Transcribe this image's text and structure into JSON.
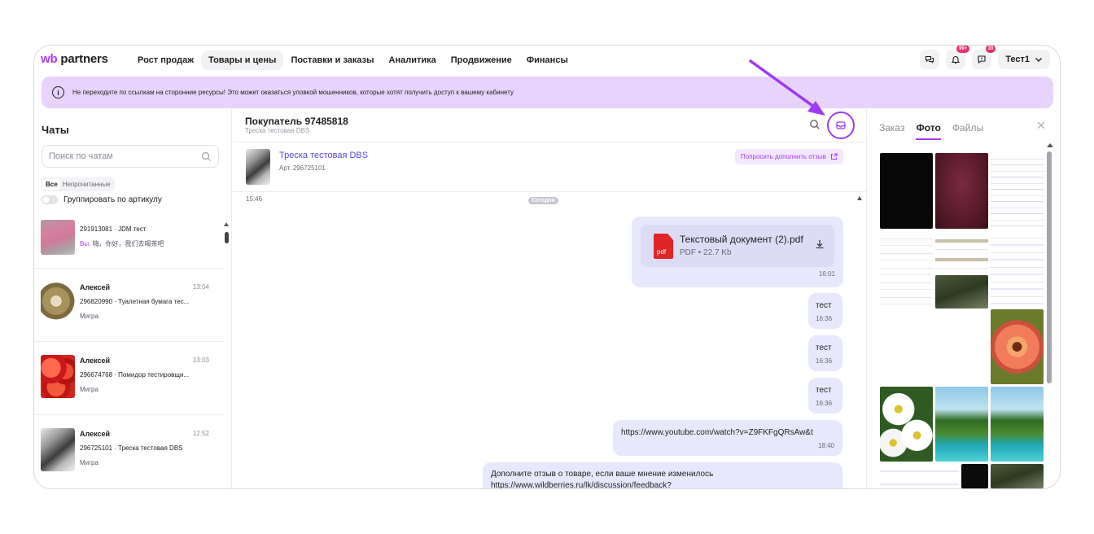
{
  "topnav": {
    "logo_wb": "wb",
    "logo_partners": "partners",
    "items": [
      "Рост продаж",
      "Товары и цены",
      "Поставки и заказы",
      "Аналитика",
      "Продвижение",
      "Финансы"
    ],
    "active_index": 1,
    "notifications_badge": "99+",
    "messages_badge": "30",
    "user_name": "Тест1"
  },
  "banner": {
    "text": "Не переходите по ссылкам на сторонние ресурсы! Это может оказаться уловкой мошенников, которые хотят получить доступ к вашему кабинету"
  },
  "chats": {
    "title": "Чаты",
    "search_placeholder": "Поиск по чатам",
    "filters": [
      "Все",
      "Непрочитанные"
    ],
    "group_toggle_label": "Группировать по артикулу",
    "list": [
      {
        "name": "",
        "time": "",
        "sub": "291913081 · JDM тест",
        "last_prefix": "Вы:",
        "last": "嗨，你好，我们去喝茶吧"
      },
      {
        "name": "Алексей",
        "time": "13:04",
        "sub": "296820990 · Туалетная бумага тес...",
        "last_prefix": "",
        "last": "Мигра"
      },
      {
        "name": "Алексей",
        "time": "13:03",
        "sub": "296674768 · Помидор тестировщи...",
        "last_prefix": "",
        "last": "Мигра"
      },
      {
        "name": "Алексей",
        "time": "12:52",
        "sub": "296725101 · Треска тестовая DBS",
        "last_prefix": "",
        "last": "Мигра"
      }
    ]
  },
  "conversation": {
    "buyer": "Покупатель 97485818",
    "buyer_sub": "Треска тестовая DBS",
    "product_name": "Треска тестовая DBS",
    "product_art": "Арт. 296725101",
    "review_button": "Попросить дополнить отзыв",
    "earlier_time": "15:46",
    "day_label": "Сегодня",
    "file": {
      "name": "Текстовый документ (2).pdf",
      "meta": "PDF • 22.7 Kb",
      "icon_label": "pdf",
      "time": "16:01"
    },
    "messages": [
      {
        "text": "тест",
        "time": "16:36"
      },
      {
        "text": "тест",
        "time": "16:36"
      },
      {
        "text": "тест",
        "time": "16:36"
      },
      {
        "text": "https://www.youtube.com/watch?v=Z9FKFgQRsAw&t",
        "time": "18:40"
      }
    ],
    "last_message_line1": "Дополните отзыв о товаре, если ваше мнение изменилось",
    "last_message_line2": "https://www.wildberries.ru/lk/discussion/feedback?"
  },
  "media": {
    "tabs": [
      "Заказ",
      "Фото",
      "Файлы"
    ],
    "active_tab": 1
  },
  "colors": {
    "accent": "#a73afd",
    "banner": "#e7d3fb",
    "bubble": "#e7e8fb",
    "annotation": "#9f3af3"
  }
}
